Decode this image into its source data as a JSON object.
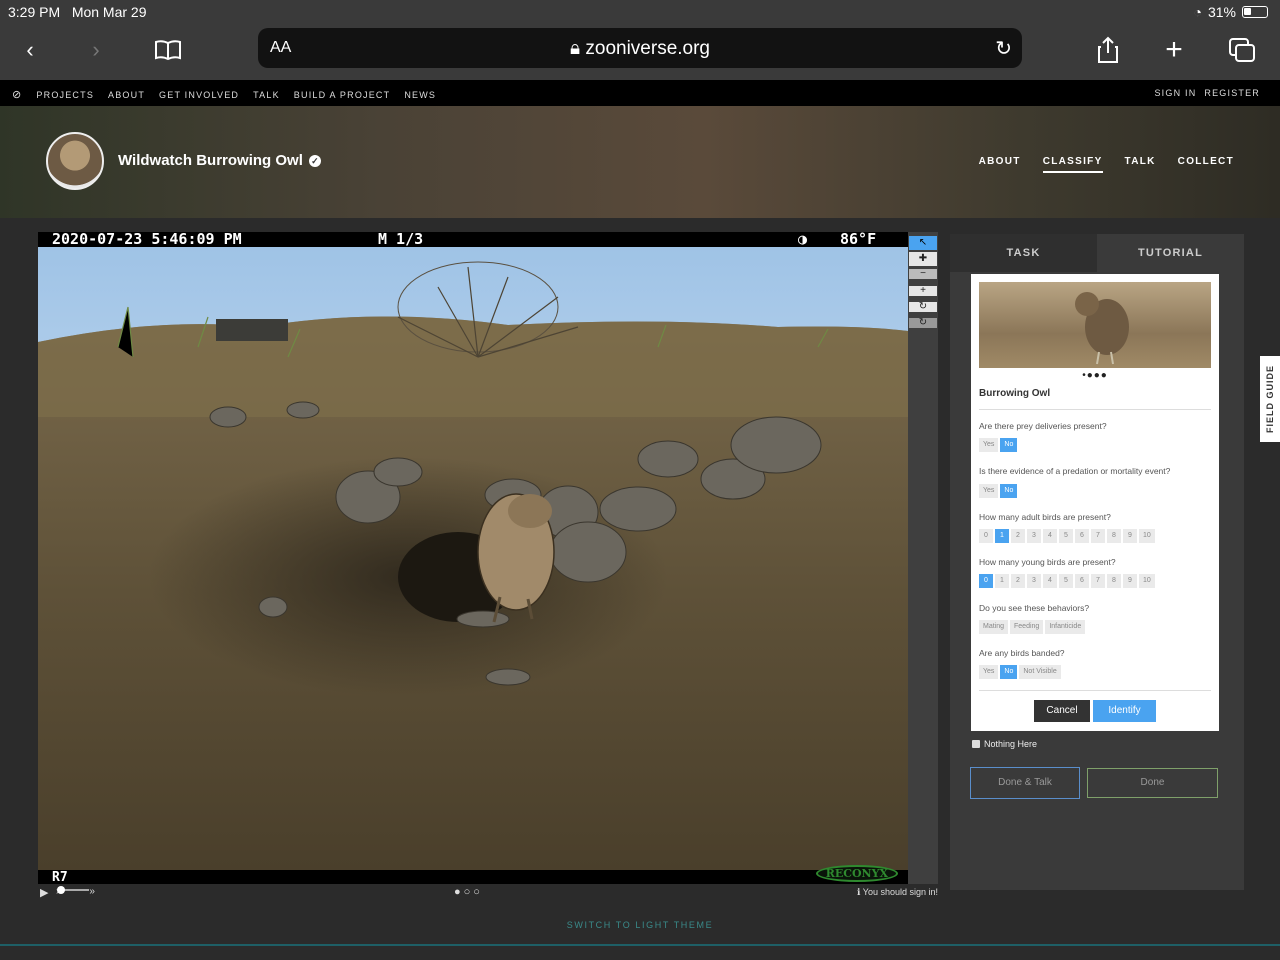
{
  "status": {
    "time": "3:29 PM",
    "date": "Mon Mar 29",
    "battery": "31%"
  },
  "browser": {
    "aa": "AA",
    "url": "zooniverse.org"
  },
  "topnav": {
    "items": [
      "PROJECTS",
      "ABOUT",
      "GET INVOLVED",
      "TALK",
      "BUILD A PROJECT",
      "NEWS"
    ],
    "sign_in": "SIGN IN",
    "register": "REGISTER"
  },
  "project": {
    "title": "Wildwatch Burrowing Owl",
    "nav": [
      "ABOUT",
      "CLASSIFY",
      "TALK",
      "COLLECT"
    ]
  },
  "camera": {
    "timestamp": "2020-07-23  5:46:09 PM",
    "frame": "M 1/3",
    "temp": "86°F",
    "code": "R7",
    "brand": "RECONYX"
  },
  "viewer": {
    "sign_in_note": "You should sign in!"
  },
  "panel": {
    "tabs": [
      "TASK",
      "TUTORIAL"
    ],
    "species": "Burrowing Owl",
    "questions": [
      {
        "label": "Are there prey deliveries present?",
        "options": [
          "Yes",
          "No"
        ],
        "selected": "No"
      },
      {
        "label": "Is there evidence of a predation or mortality event?",
        "options": [
          "Yes",
          "No"
        ],
        "selected": "No"
      },
      {
        "label": "How many adult birds are present?",
        "options": [
          "0",
          "1",
          "2",
          "3",
          "4",
          "5",
          "6",
          "7",
          "8",
          "9",
          "10"
        ],
        "selected": "1"
      },
      {
        "label": "How many young birds are present?",
        "options": [
          "0",
          "1",
          "2",
          "3",
          "4",
          "5",
          "6",
          "7",
          "8",
          "9",
          "10"
        ],
        "selected": "0"
      },
      {
        "label": "Do you see these behaviors?",
        "options": [
          "Mating",
          "Feeding",
          "Infanticide"
        ],
        "selected": ""
      },
      {
        "label": "Are any birds banded?",
        "options": [
          "Yes",
          "No",
          "Not Visible"
        ],
        "selected": "No"
      }
    ],
    "cancel": "Cancel",
    "identify": "Identify",
    "nothing_here": "Nothing Here",
    "done_talk": "Done & Talk",
    "done": "Done"
  },
  "field_guide": "FIELD GUIDE",
  "theme_link": "SWITCH TO LIGHT THEME",
  "colors": {
    "accent": "#4aa3f0",
    "done_talk_border": "#5a8ecb",
    "done_border": "#7fa06a"
  }
}
